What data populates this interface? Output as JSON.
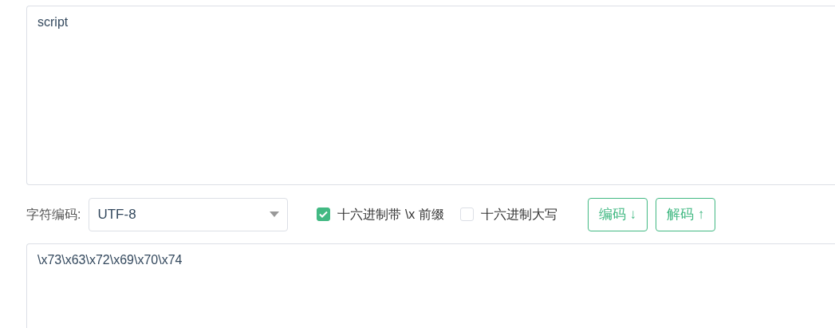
{
  "input": {
    "value": "script"
  },
  "options": {
    "charset_label": "字符编码:",
    "charset": "UTF-8",
    "checkboxes": [
      {
        "label": "十六进制带 \\x 前缀",
        "checked": true
      },
      {
        "label": "十六进制大写",
        "checked": false
      }
    ],
    "buttons": [
      {
        "label": "编码",
        "arrow": "↓"
      },
      {
        "label": "解码",
        "arrow": "↑"
      }
    ]
  },
  "output": {
    "value": "\\x73\\x63\\x72\\x69\\x70\\x74"
  }
}
